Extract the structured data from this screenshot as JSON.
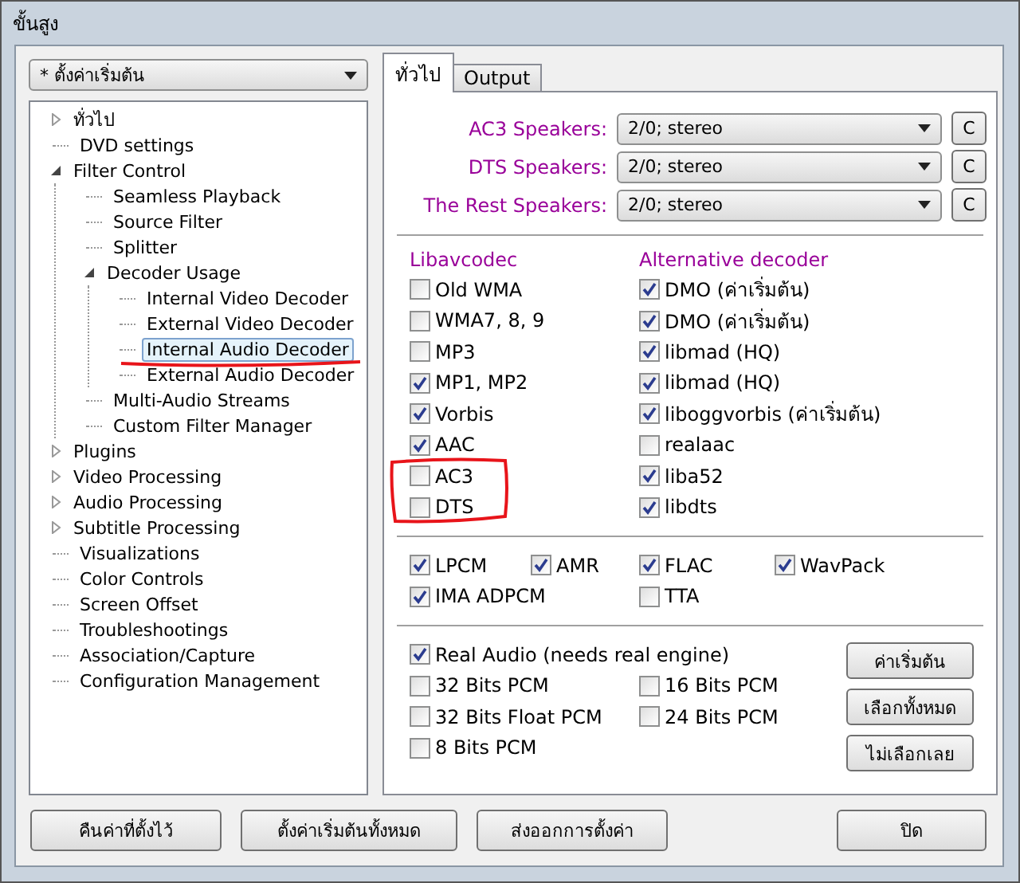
{
  "window": {
    "title": "ขั้นสูง"
  },
  "preset": {
    "value": "* ตั้งค่าเริ่มต้น"
  },
  "tree": [
    {
      "label": "ทั่วไป",
      "kind": "folder",
      "expanded": false,
      "selected": false
    },
    {
      "label": "DVD settings",
      "kind": "leaf",
      "selected": false
    },
    {
      "label": "Filter Control",
      "kind": "folder",
      "expanded": true,
      "selected": false,
      "children": [
        {
          "label": "Seamless Playback",
          "kind": "leaf",
          "selected": false
        },
        {
          "label": "Source Filter",
          "kind": "leaf",
          "selected": false
        },
        {
          "label": "Splitter",
          "kind": "leaf",
          "selected": false
        },
        {
          "label": "Decoder Usage",
          "kind": "folder",
          "expanded": true,
          "selected": false,
          "children": [
            {
              "label": "Internal Video Decoder",
              "kind": "leaf",
              "selected": false
            },
            {
              "label": "External Video Decoder",
              "kind": "leaf",
              "selected": false
            },
            {
              "label": "Internal Audio Decoder",
              "kind": "leaf",
              "selected": true
            },
            {
              "label": "External Audio Decoder",
              "kind": "leaf",
              "selected": false
            }
          ]
        },
        {
          "label": "Multi-Audio Streams",
          "kind": "leaf",
          "selected": false
        },
        {
          "label": "Custom Filter Manager",
          "kind": "leaf",
          "selected": false
        }
      ]
    },
    {
      "label": "Plugins",
      "kind": "folder",
      "expanded": false,
      "selected": false
    },
    {
      "label": "Video Processing",
      "kind": "folder",
      "expanded": false,
      "selected": false
    },
    {
      "label": "Audio Processing",
      "kind": "folder",
      "expanded": false,
      "selected": false
    },
    {
      "label": "Subtitle Processing",
      "kind": "folder",
      "expanded": false,
      "selected": false
    },
    {
      "label": "Visualizations",
      "kind": "leaf",
      "selected": false
    },
    {
      "label": "Color Controls",
      "kind": "leaf",
      "selected": false
    },
    {
      "label": "Screen Offset",
      "kind": "leaf",
      "selected": false
    },
    {
      "label": "Troubleshootings",
      "kind": "leaf",
      "selected": false
    },
    {
      "label": "Association/Capture",
      "kind": "leaf",
      "selected": false
    },
    {
      "label": "Configuration Management",
      "kind": "leaf",
      "selected": false
    }
  ],
  "tabs": [
    {
      "label": "ทั่วไป",
      "selected": true
    },
    {
      "label": "Output",
      "selected": false
    }
  ],
  "speakers": [
    {
      "label": "AC3 Speakers:",
      "value": "2/0; stereo",
      "reset": "C"
    },
    {
      "label": "DTS Speakers:",
      "value": "2/0; stereo",
      "reset": "C"
    },
    {
      "label": "The Rest Speakers:",
      "value": "2/0; stereo",
      "reset": "C"
    }
  ],
  "decoders": [
    {
      "title": "Libavcodec",
      "items": [
        {
          "label": "Old WMA",
          "checked": false
        },
        {
          "label": "WMA7, 8, 9",
          "checked": false
        },
        {
          "label": "MP3",
          "checked": false
        },
        {
          "label": "MP1, MP2",
          "checked": true
        },
        {
          "label": "Vorbis",
          "checked": true
        },
        {
          "label": "AAC",
          "checked": true
        },
        {
          "label": "AC3",
          "checked": false
        },
        {
          "label": "DTS",
          "checked": false
        }
      ]
    },
    {
      "title": "Alternative decoder",
      "items": [
        {
          "label": "DMO (ค่าเริ่มต้น)",
          "checked": true
        },
        {
          "label": "DMO (ค่าเริ่มต้น)",
          "checked": true
        },
        {
          "label": "libmad (HQ)",
          "checked": true
        },
        {
          "label": "libmad (HQ)",
          "checked": true
        },
        {
          "label": "liboggvorbis (ค่าเริ่มต้น)",
          "checked": true
        },
        {
          "label": "realaac",
          "checked": false
        },
        {
          "label": "liba52",
          "checked": true
        },
        {
          "label": "libdts",
          "checked": true
        }
      ]
    }
  ],
  "formats": [
    [
      {
        "label": "LPCM",
        "checked": true
      },
      {
        "label": "AMR",
        "checked": true
      },
      {
        "label": "FLAC",
        "checked": true
      },
      {
        "label": "WavPack",
        "checked": true
      }
    ],
    [
      {
        "label": "IMA ADPCM",
        "checked": true
      },
      {
        "label": "TTA",
        "checked": false
      }
    ]
  ],
  "pcm": [
    [
      {
        "label": "Real Audio (needs real engine)",
        "checked": true
      }
    ],
    [
      {
        "label": "32 Bits PCM",
        "checked": false
      },
      {
        "label": "16 Bits PCM",
        "checked": false
      }
    ],
    [
      {
        "label": "32 Bits Float PCM",
        "checked": false
      },
      {
        "label": "24 Bits PCM",
        "checked": false
      }
    ],
    [
      {
        "label": "8 Bits PCM",
        "checked": false
      }
    ]
  ],
  "pcm_buttons": [
    "ค่าเริ่มต้น",
    "เลือกทั้งหมด",
    "ไม่เลือกเลย"
  ],
  "footer_buttons": [
    "คืนค่าที่ตั้งไว้",
    "ตั้งค่าเริ่มต้นทั้งหมด",
    "ส่งออกการตั้งค่า",
    "ปิด"
  ]
}
